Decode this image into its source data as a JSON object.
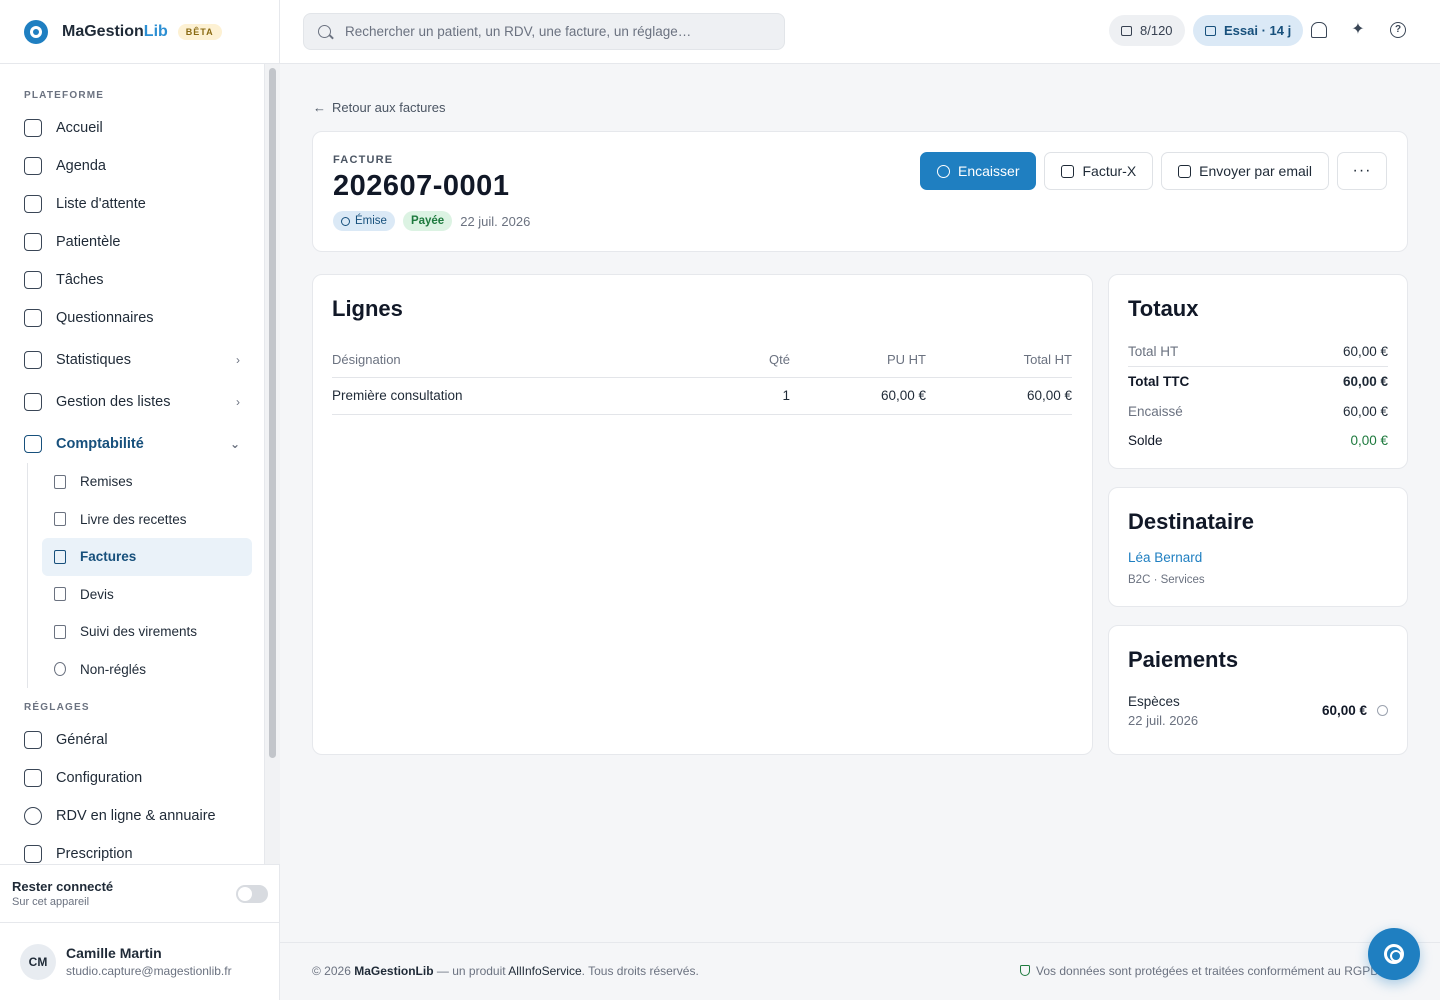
{
  "brand": {
    "name_main": "MaGestion",
    "name_accent": "Lib",
    "badge": "BÊTA"
  },
  "search": {
    "placeholder": "Rechercher un patient, un RDV, une facture, un réglage…"
  },
  "topbar": {
    "sms_counter": "8/120",
    "trial": "Essai · 14 j"
  },
  "sidebar": {
    "section_platform": "PLATEFORME",
    "items": [
      {
        "label": "Accueil"
      },
      {
        "label": "Agenda"
      },
      {
        "label": "Liste d'attente"
      },
      {
        "label": "Patientèle"
      },
      {
        "label": "Tâches"
      },
      {
        "label": "Questionnaires"
      },
      {
        "label": "Statistiques"
      },
      {
        "label": "Gestion des listes"
      },
      {
        "label": "Comptabilité"
      }
    ],
    "sub_items": [
      {
        "label": "Remises"
      },
      {
        "label": "Livre des recettes"
      },
      {
        "label": "Factures"
      },
      {
        "label": "Devis"
      },
      {
        "label": "Suivi des virements"
      },
      {
        "label": "Non-réglés"
      }
    ],
    "section_settings": "RÉGLAGES",
    "settings_items": [
      {
        "label": "Général"
      },
      {
        "label": "Configuration"
      },
      {
        "label": "RDV en ligne & annuaire"
      },
      {
        "label": "Prescription"
      }
    ],
    "stay": {
      "title": "Rester connecté",
      "subtitle": "Sur cet appareil"
    },
    "user": {
      "initials": "CM",
      "name": "Camille Martin",
      "email": "studio.capture@magestionlib.fr"
    }
  },
  "invoice": {
    "back": "Retour aux factures",
    "kicker": "FACTURE",
    "number": "202607-0001",
    "status_emise": "Émise",
    "status_payee": "Payée",
    "date": "22 juil. 2026",
    "actions": {
      "encaisser": "Encaisser",
      "facturx": "Factur-X",
      "email": "Envoyer par email",
      "more": "···"
    }
  },
  "lines": {
    "title": "Lignes",
    "headers": {
      "designation": "Désignation",
      "qty": "Qté",
      "pu": "PU HT",
      "total": "Total HT"
    },
    "rows": [
      {
        "designation": "Première consultation",
        "qty": "1",
        "pu": "60,00 €",
        "total": "60,00 €"
      }
    ]
  },
  "totals": {
    "title": "Totaux",
    "total_ht_label": "Total HT",
    "total_ht": "60,00 €",
    "total_ttc_label": "Total TTC",
    "total_ttc": "60,00 €",
    "encaisse_label": "Encaissé",
    "encaisse": "60,00 €",
    "solde_label": "Solde",
    "solde": "0,00 €"
  },
  "recipient": {
    "title": "Destinataire",
    "name": "Léa Bernard",
    "meta": "B2C · Services"
  },
  "payments": {
    "title": "Paiements",
    "method": "Espèces",
    "date": "22 juil. 2026",
    "amount": "60,00 €"
  },
  "footer": {
    "left_prefix": "© 2026 ",
    "left_brand": "MaGestionLib",
    "left_mid": " — un produit ",
    "left_company": "AllInfoService",
    "left_suffix": ". Tous droits réservés.",
    "right": "Vos données sont protégées et traitées conformément au RGPD"
  }
}
